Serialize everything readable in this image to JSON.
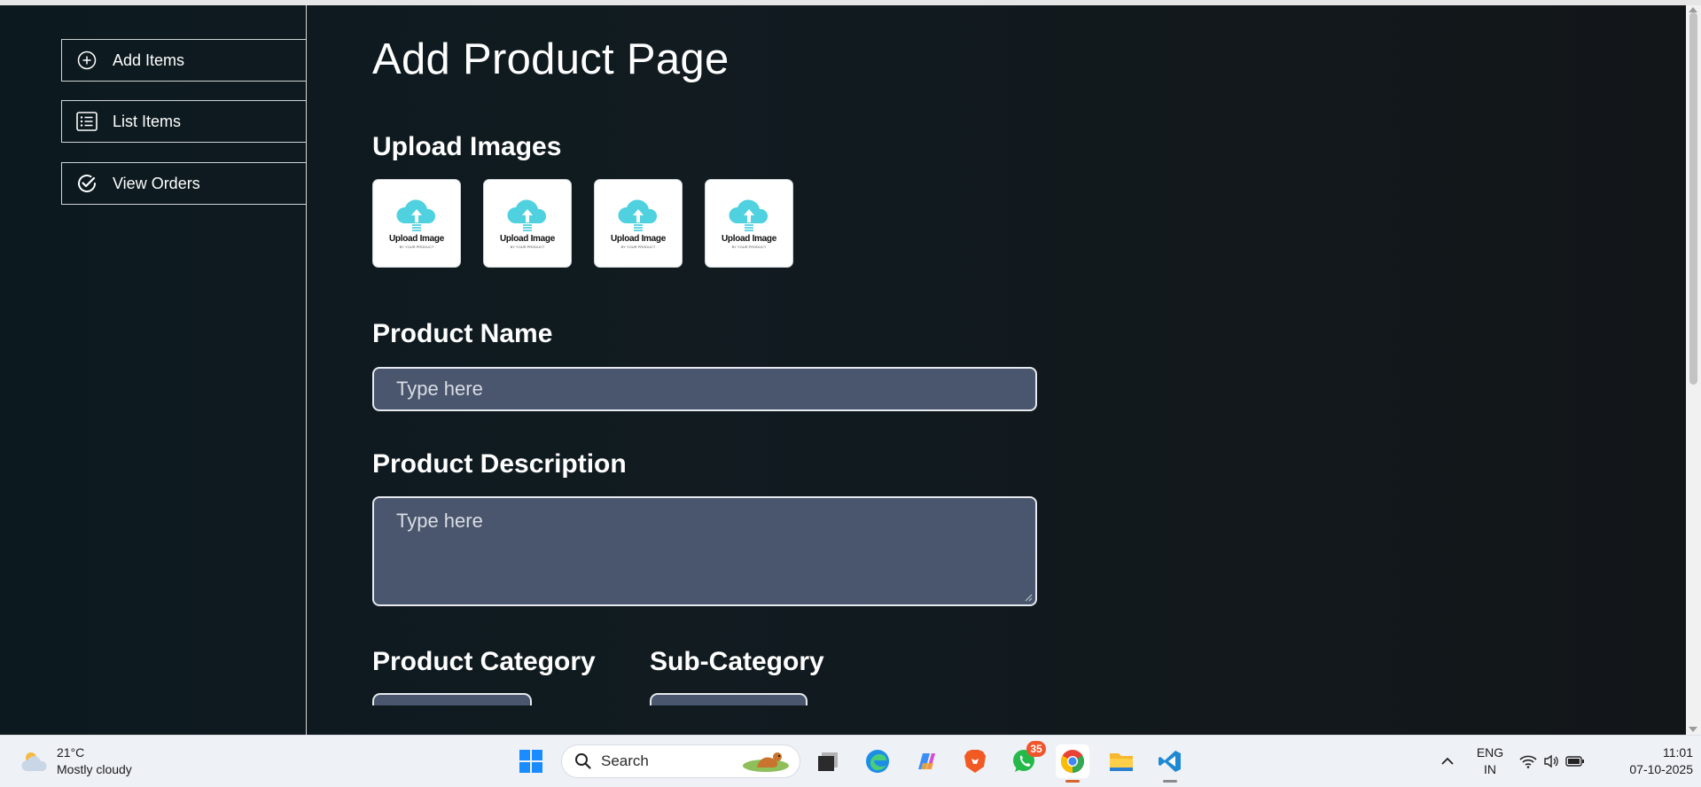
{
  "sidebar": {
    "items": [
      {
        "label": "Add Items",
        "icon": "plus-circle-icon"
      },
      {
        "label": "List Items",
        "icon": "list-icon"
      },
      {
        "label": "View Orders",
        "icon": "check-circle-icon"
      }
    ]
  },
  "main": {
    "page_title": "Add Product Page",
    "upload_section": {
      "label": "Upload Images",
      "box_text": "Upload Image",
      "box_subtext": "BY YOUR PRODUCT",
      "box_count": 4
    },
    "product_name": {
      "label": "Product Name",
      "placeholder": "Type here",
      "value": ""
    },
    "product_description": {
      "label": "Product Description",
      "placeholder": "Type here",
      "value": ""
    },
    "product_category": {
      "label": "Product Category"
    },
    "sub_category": {
      "label": "Sub-Category"
    }
  },
  "taskbar": {
    "weather": {
      "temperature": "21°C",
      "condition": "Mostly cloudy",
      "icon": "cloud-sun-icon"
    },
    "search_placeholder": "Search",
    "whatsapp_badge": "35",
    "language": {
      "line1": "ENG",
      "line2": "IN"
    },
    "clock": {
      "time": "11:01",
      "date": "07-10-2025"
    }
  },
  "colors": {
    "accent_cyan": "#4fd1e0",
    "input_bg": "#4a566d",
    "app_bg": "#0f1a1e",
    "badge": "#f0552c"
  }
}
